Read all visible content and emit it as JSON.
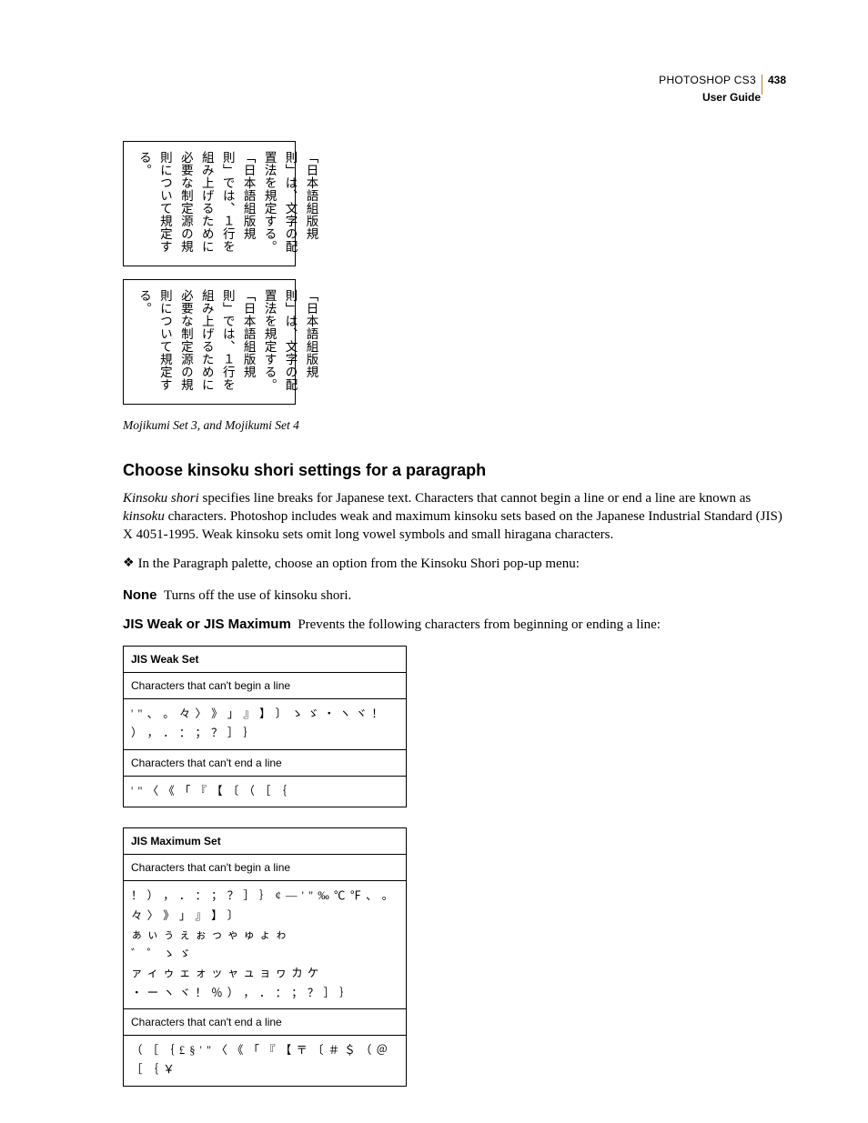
{
  "header": {
    "app": "PHOTOSHOP CS3",
    "page": "438",
    "guide": "User Guide"
  },
  "figure": {
    "box1": "「日本語組版規則」は、文字の配置法を規定する。「日本語組版規則」では、１行を組み上げるために必要な制定源の規則について規定する。",
    "box2": "「日本語組版規則」は、文字の配置法を規定する。「日本語組版規則」では、１行を組み上げるために必要な制定源の規則について規定する。",
    "caption": "Mojikumi Set 3, and Mojikumi Set 4"
  },
  "heading": "Choose kinsoku shori settings for a paragraph",
  "para1a": "Kinsoku shori",
  "para1b": " specifies line breaks for Japanese text. Characters that cannot begin a line or end a line are known as ",
  "para1c": "kinsoku",
  "para1d": " characters. Photoshop includes weak and maximum kinsoku sets based on the Japanese Industrial Standard (JIS) X 4051-1995. Weak kinsoku sets omit long vowel symbols and small hiragana characters.",
  "bullet": "In the Paragraph palette, choose an option from the Kinsoku Shori pop-up menu:",
  "none_label": "None",
  "none_text": "Turns off the use of kinsoku shori.",
  "jis_label": "JIS Weak or JIS Maximum",
  "jis_text": "Prevents the following characters from beginning or ending a line:",
  "weak": {
    "title": "JIS Weak Set",
    "begin_label": "Characters that can't begin a line",
    "begin_chars": "' \" 、 。 々 〉 》 」 』 】 〕 ゝ ゞ ・ ヽ ヾ ！ ） ， ． ： ； ？ ］ ｝",
    "end_label": "Characters that can't end a line",
    "end_chars": "' \" 〈 《 「 『 【 〔 （ ［ ｛"
  },
  "max": {
    "title": "JIS Maximum Set",
    "begin_label": "Characters that can't begin a line",
    "begin_chars": "！ ） ， ． ： ； ？ ］ ｝ ¢ — ' \" ‰ ℃ ℉ 、 。 々 〉 》 」 』 】 〕\nぁ ぃ ぅ ぇ ぉ っ ゃ ゅ ょ ゎ\n゛ ゜ ゝ ゞ\nァ ィ ゥ ェ ォ ッ ャ ュ ョ ヮ カ ケ\n・ ー ヽ ヾ ！ ％ ） ， ． ： ； ？ ］ ｝",
    "end_label": "Characters that can't end a line",
    "end_chars": "（ ［ ｛ £ § ' \" 〈 《 「 『 【 〒 〔 ＃ ＄ （ ＠ ［ ｛ ￥"
  }
}
